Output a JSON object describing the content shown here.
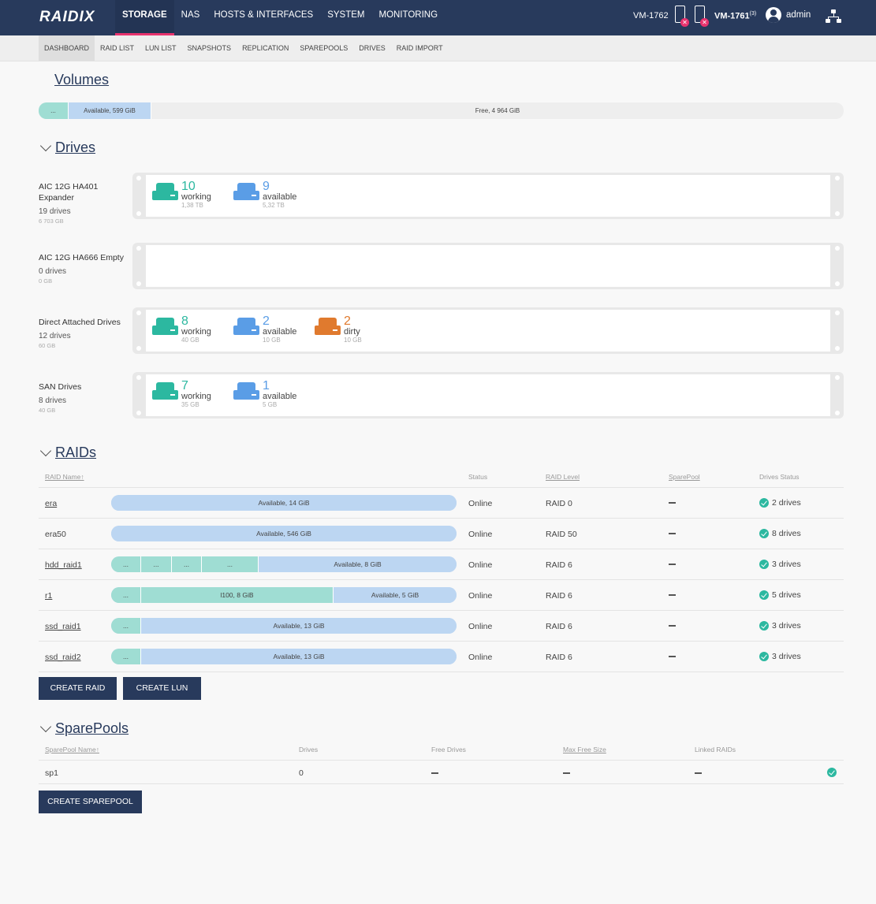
{
  "topnav": {
    "logo": "RAIDIX",
    "items": [
      "STORAGE",
      "NAS",
      "HOSTS & INTERFACES",
      "SYSTEM",
      "MONITORING"
    ],
    "node1": "VM-1762",
    "node2": "VM-1761",
    "node2_badge": "(3)",
    "user": "admin"
  },
  "subnav": {
    "items": [
      "DASHBOARD",
      "RAID LIST",
      "LUN LIST",
      "SNAPSHOTS",
      "REPLICATION",
      "SPAREPOOLS",
      "DRIVES",
      "RAID IMPORT"
    ]
  },
  "volumes": {
    "title": "Volumes",
    "segments": [
      "...",
      "Available, 599 GiB",
      "Free, 4 964 GiB"
    ]
  },
  "drives": {
    "title": "Drives",
    "enclosures": [
      {
        "name": "AIC 12G HA401 Expander",
        "count": "19 drives",
        "size": "6 703 GB",
        "groups": [
          {
            "num": "10",
            "label": "working",
            "size": "1,38 TB",
            "color": "green"
          },
          {
            "num": "9",
            "label": "available",
            "size": "5,32 TB",
            "color": "blue"
          }
        ]
      },
      {
        "name": "AIC 12G HA666 Empty",
        "count": "0 drives",
        "size": "0 GB",
        "groups": []
      },
      {
        "name": "Direct Attached Drives",
        "count": "12 drives",
        "size": "60 GB",
        "groups": [
          {
            "num": "8",
            "label": "working",
            "size": "40 GB",
            "color": "green"
          },
          {
            "num": "2",
            "label": "available",
            "size": "10 GB",
            "color": "blue"
          },
          {
            "num": "2",
            "label": "dirty",
            "size": "10 GB",
            "color": "orange"
          }
        ]
      },
      {
        "name": "SAN Drives",
        "count": "8 drives",
        "size": "40 GB",
        "groups": [
          {
            "num": "7",
            "label": "working",
            "size": "35 GB",
            "color": "green"
          },
          {
            "num": "1",
            "label": "available",
            "size": "5 GB",
            "color": "blue"
          }
        ]
      }
    ]
  },
  "raids": {
    "title": "RAIDs",
    "headers": [
      "RAID Name↑",
      "Status",
      "RAID Level",
      "SparePool",
      "Drives Status"
    ],
    "rows": [
      {
        "name": "era",
        "bar": [
          "Available, 14 GiB"
        ],
        "status": "Online",
        "level": "RAID 0",
        "drives": "2 drives"
      },
      {
        "name": "era50",
        "bar": [
          "Available, 546 GiB"
        ],
        "status": "Online",
        "level": "RAID 50",
        "drives": "8 drives"
      },
      {
        "name": "hdd_raid1",
        "bar": [
          "...",
          "...",
          "...",
          "...",
          "Available, 8 GiB"
        ],
        "status": "Online",
        "level": "RAID 6",
        "drives": "3 drives"
      },
      {
        "name": "r1",
        "bar": [
          "...",
          "l100, 8 GiB",
          "Available, 5 GiB"
        ],
        "status": "Online",
        "level": "RAID 6",
        "drives": "5 drives"
      },
      {
        "name": "ssd_raid1",
        "bar": [
          "...",
          "Available, 13 GiB"
        ],
        "status": "Online",
        "level": "RAID 6",
        "drives": "3 drives"
      },
      {
        "name": "ssd_raid2",
        "bar": [
          "...",
          "Available, 13 GiB"
        ],
        "status": "Online",
        "level": "RAID 6",
        "drives": "3 drives"
      }
    ],
    "create_raid": "CREATE RAID",
    "create_lun": "CREATE LUN"
  },
  "sparepools": {
    "title": "SparePools",
    "headers": [
      "SparePool Name↑",
      "Drives",
      "Free Drives",
      "Max Free Size",
      "Linked RAIDs"
    ],
    "rows": [
      {
        "name": "sp1",
        "drives": "0"
      }
    ],
    "create": "CREATE SPAREPOOL"
  }
}
